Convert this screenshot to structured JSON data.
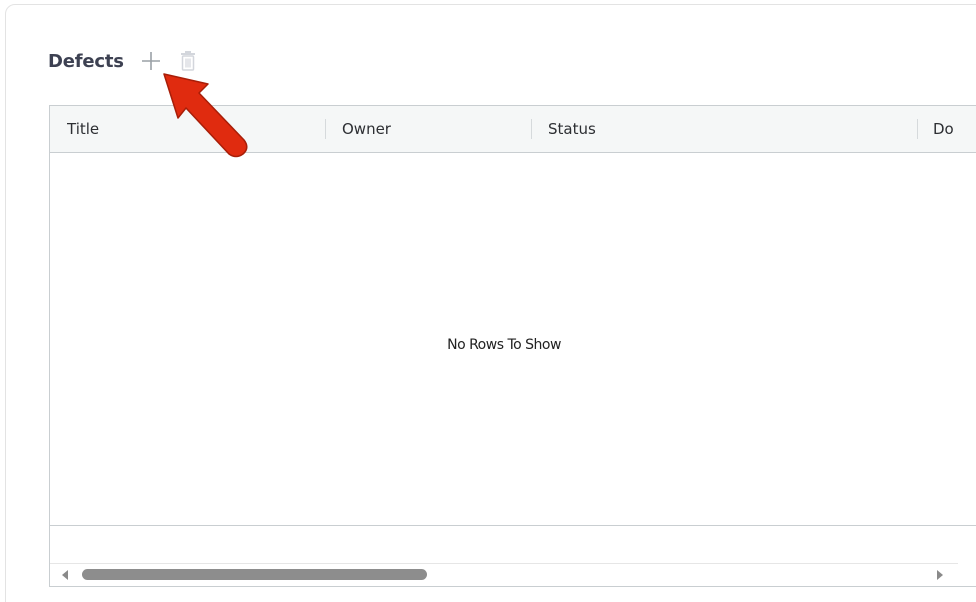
{
  "section": {
    "title": "Defects",
    "add_icon": "plus-icon",
    "delete_icon": "trash-icon"
  },
  "grid": {
    "columns": [
      {
        "label": "Title"
      },
      {
        "label": "Owner"
      },
      {
        "label": "Status"
      },
      {
        "label": "Do"
      }
    ],
    "empty_message": "No Rows To Show"
  },
  "colors": {
    "title_text": "#3d4152",
    "icon_muted": "#9aa0a6",
    "header_bg": "#f5f7f7",
    "border": "#c9ced1",
    "annotation_arrow": "#e02b0f",
    "scroll_thumb": "#8d8d8d"
  }
}
